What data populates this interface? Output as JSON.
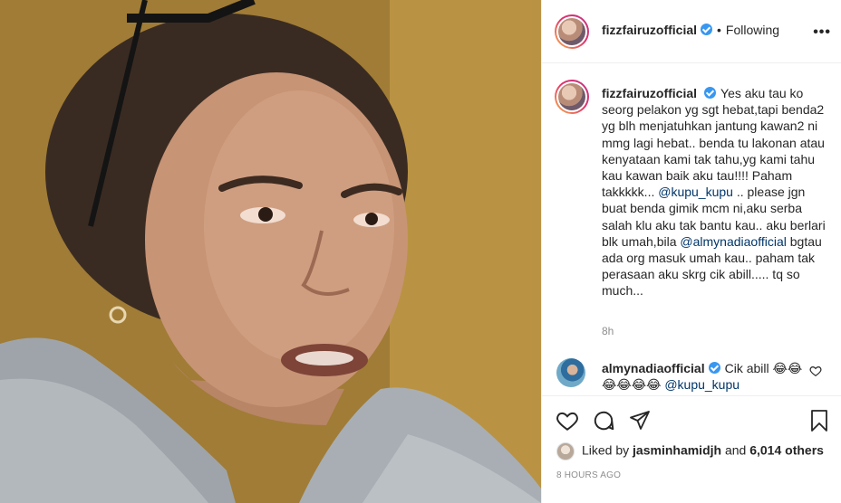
{
  "post": {
    "username": "fizzfairuzofficial",
    "follow_status": "Following",
    "separator": "•",
    "more_label": "•••"
  },
  "caption": {
    "username": "fizzfairuzofficial",
    "text_1": "Yes aku tau ko seorg pelakon yg sgt hebat,tapi benda2 yg blh menjatuhkan jantung kawan2 ni mmg lagi hebat.. benda tu lakonan atau kenyataan kami tak tahu,yg kami tahu kau kawan baik aku tau!!!! Paham takkkkk... ",
    "mention_1": "@kupu_kupu",
    "text_2": " .. please jgn buat benda gimik mcm ni,aku serba salah klu aku tak bantu kau.. aku berlari blk umah,bila ",
    "mention_2": "@almynadiaofficial",
    "text_3": " bgtau ada org masuk umah kau.. paham tak perasaan aku skrg cik abill..... tq so much...",
    "time": "8h"
  },
  "comment": {
    "username": "almynadiaofficial",
    "text": "Cik abill 😂😂😂😂😂😂 ",
    "mention": "@kupu_kupu"
  },
  "likes": {
    "prefix": "Liked by",
    "user": "jasminhamidjh",
    "and": "and",
    "count": "6,014 others"
  },
  "posted_time": "8 HOURS AGO",
  "colors": {
    "verified": "#3897f0",
    "mention": "#003569",
    "muted": "#8e8e8e"
  },
  "icons": [
    "verified-badge-icon",
    "more-options-icon",
    "heart-icon",
    "comment-icon",
    "share-icon",
    "bookmark-icon"
  ]
}
